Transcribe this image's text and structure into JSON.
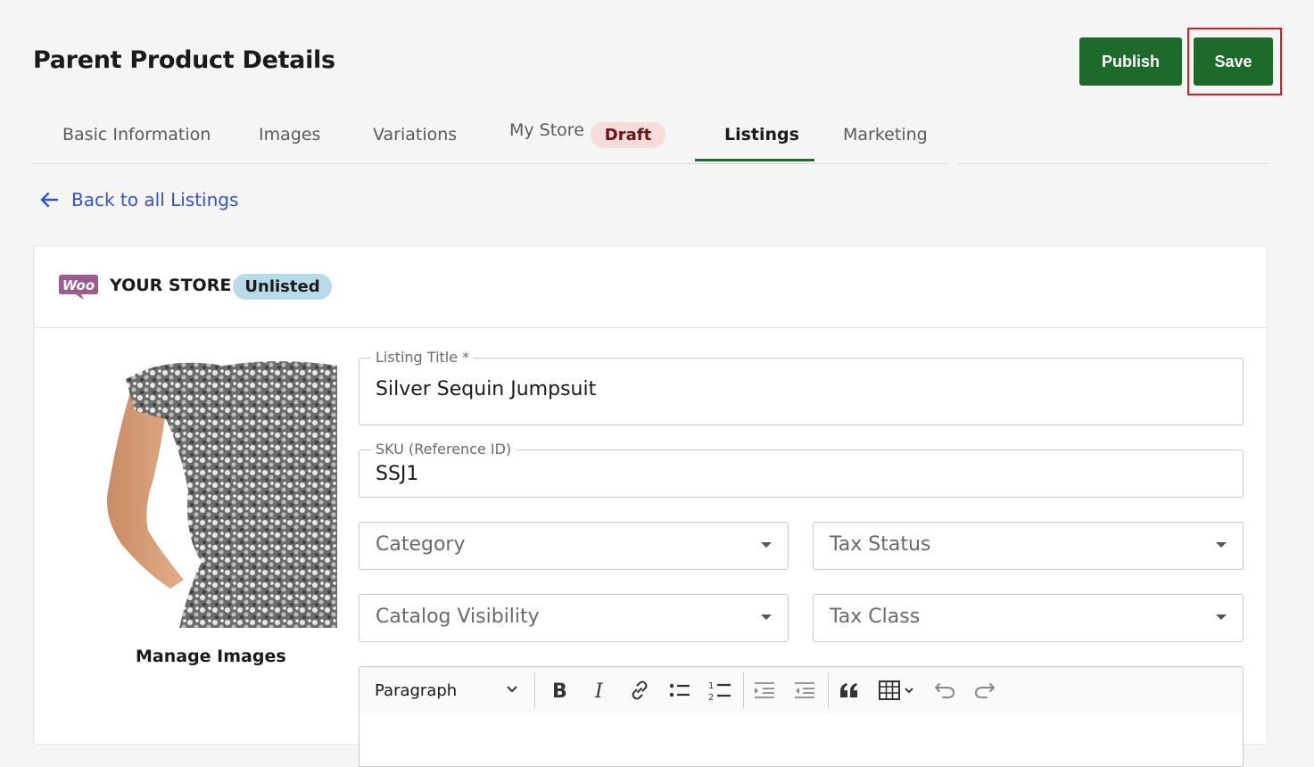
{
  "header": {
    "title": "Parent Product Details",
    "publish_label": "Publish",
    "save_label": "Save"
  },
  "tabs": [
    {
      "label": "Basic Information"
    },
    {
      "label": "Images"
    },
    {
      "label": "Variations"
    },
    {
      "label": "My Store",
      "badge": "Draft"
    },
    {
      "label": "Listings",
      "active": true
    },
    {
      "label": "Marketing"
    }
  ],
  "back_link": "Back to all Listings",
  "store": {
    "logo_text": "WOO",
    "name": "YOUR STORE",
    "status_badge": "Unlisted"
  },
  "product": {
    "manage_images_label": "Manage Images",
    "listing_title_label": "Listing Title *",
    "listing_title_value": "Silver Sequin Jumpsuit",
    "sku_label": "SKU (Reference ID)",
    "sku_value": "SSJ1",
    "category_placeholder": "Category",
    "tax_status_placeholder": "Tax Status",
    "catalog_visibility_placeholder": "Catalog Visibility",
    "tax_class_placeholder": "Tax Class"
  },
  "editor": {
    "block_format": "Paragraph",
    "tools": [
      "bold-icon",
      "italic-icon",
      "link-icon",
      "bulleted-list-icon",
      "numbered-list-icon",
      "outdent-icon",
      "indent-icon",
      "blockquote-icon",
      "table-icon",
      "undo-icon",
      "redo-icon"
    ]
  },
  "colors": {
    "primary_green": "#1e6a2b",
    "link_blue": "#3551d9",
    "highlight_red": "#e0191f",
    "draft_bg": "#f7dcdc",
    "unlisted_bg": "#b8dbe9"
  }
}
